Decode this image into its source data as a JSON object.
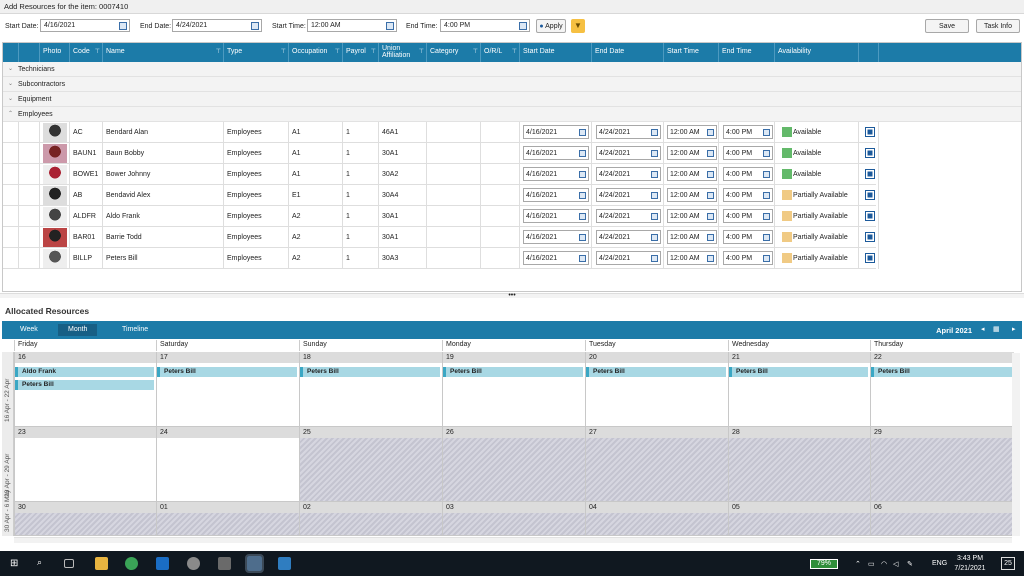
{
  "window": {
    "title": "Add Resources for the item: 0007410"
  },
  "filters": {
    "start_date_label": "Start Date:",
    "start_date": "4/16/2021",
    "end_date_label": "End Date:",
    "end_date": "4/24/2021",
    "start_time_label": "Start Time:",
    "start_time": "12:00 AM",
    "end_time_label": "End Time:",
    "end_time": "4:00 PM",
    "apply_label": "Apply",
    "save_label": "Save",
    "task_info_label": "Task Info"
  },
  "grid": {
    "columns": {
      "photo": "Photo",
      "code": "Code",
      "name": "Name",
      "type": "Type",
      "occupation": "Occupation",
      "payrol": "Payrol",
      "union_1": "Union",
      "union_2": "Affiliation",
      "category": "Category",
      "orl": "O/R/L",
      "start_date": "Start Date",
      "end_date": "End Date",
      "start_time": "Start Time",
      "end_time": "End Time",
      "availability": "Availability"
    },
    "groups": [
      "Technicians",
      "Subcontractors",
      "Equipment",
      "Employees"
    ],
    "rows": [
      {
        "code": "AC",
        "name": "Bendard Alan",
        "type": "Employees",
        "occupation": "A1",
        "payrol": "1",
        "union": "46A1",
        "start_date": "4/16/2021",
        "end_date": "4/24/2021",
        "start_time": "12:00 AM",
        "end_time": "4:00 PM",
        "availability": "Available"
      },
      {
        "code": "BAUN1",
        "name": "Baun Bobby",
        "type": "Employees",
        "occupation": "A1",
        "payrol": "1",
        "union": "30A1",
        "start_date": "4/16/2021",
        "end_date": "4/24/2021",
        "start_time": "12:00 AM",
        "end_time": "4:00 PM",
        "availability": "Available"
      },
      {
        "code": "BOWE1",
        "name": "Bower Johnny",
        "type": "Employees",
        "occupation": "A1",
        "payrol": "1",
        "union": "30A2",
        "start_date": "4/16/2021",
        "end_date": "4/24/2021",
        "start_time": "12:00 AM",
        "end_time": "4:00 PM",
        "availability": "Available"
      },
      {
        "code": "AB",
        "name": "Bendavid Alex",
        "type": "Employees",
        "occupation": "E1",
        "payrol": "1",
        "union": "30A4",
        "start_date": "4/16/2021",
        "end_date": "4/24/2021",
        "start_time": "12:00 AM",
        "end_time": "4:00 PM",
        "availability": "Partially Available"
      },
      {
        "code": "ALDFR",
        "name": "Aldo Frank",
        "type": "Employees",
        "occupation": "A2",
        "payrol": "1",
        "union": "30A1",
        "start_date": "4/16/2021",
        "end_date": "4/24/2021",
        "start_time": "12:00 AM",
        "end_time": "4:00 PM",
        "availability": "Partially Available"
      },
      {
        "code": "BAR01",
        "name": "Barrie Todd",
        "type": "Employees",
        "occupation": "A2",
        "payrol": "1",
        "union": "30A1",
        "start_date": "4/16/2021",
        "end_date": "4/24/2021",
        "start_time": "12:00 AM",
        "end_time": "4:00 PM",
        "availability": "Partially Available"
      },
      {
        "code": "BILLP",
        "name": "Peters Bill",
        "type": "Employees",
        "occupation": "A2",
        "payrol": "1",
        "union": "30A3",
        "start_date": "4/16/2021",
        "end_date": "4/24/2021",
        "start_time": "12:00 AM",
        "end_time": "4:00 PM",
        "availability": "Partially Available"
      }
    ]
  },
  "allocated": {
    "title": "Allocated Resources",
    "tabs": [
      "Week",
      "Month",
      "Timeline"
    ],
    "month_label": "April 2021",
    "day_names": [
      "Friday",
      "Saturday",
      "Sunday",
      "Monday",
      "Tuesday",
      "Wednesday",
      "Thursday"
    ],
    "week_labels": [
      "16 Apr - 22 Apr",
      "23 Apr - 29 Apr",
      "30 Apr - 6 May"
    ],
    "weeks": [
      [
        "16",
        "17",
        "18",
        "19",
        "20",
        "21",
        "22"
      ],
      [
        "23",
        "24",
        "25",
        "26",
        "27",
        "28",
        "29"
      ],
      [
        "30",
        "01",
        "02",
        "03",
        "04",
        "05",
        "06"
      ]
    ],
    "appointments": {
      "aldo": "Aldo Frank",
      "peters": "Peters Bill"
    }
  },
  "taskbar": {
    "battery": "79%",
    "lang": "ENG",
    "time": "3:43 PM",
    "date": "7/21/2021",
    "notifications": "25"
  },
  "colors": {
    "header": "#1c7ba8",
    "available": "#63b96a",
    "partial": "#f0ca84",
    "appointment": "#a8d8e4"
  }
}
